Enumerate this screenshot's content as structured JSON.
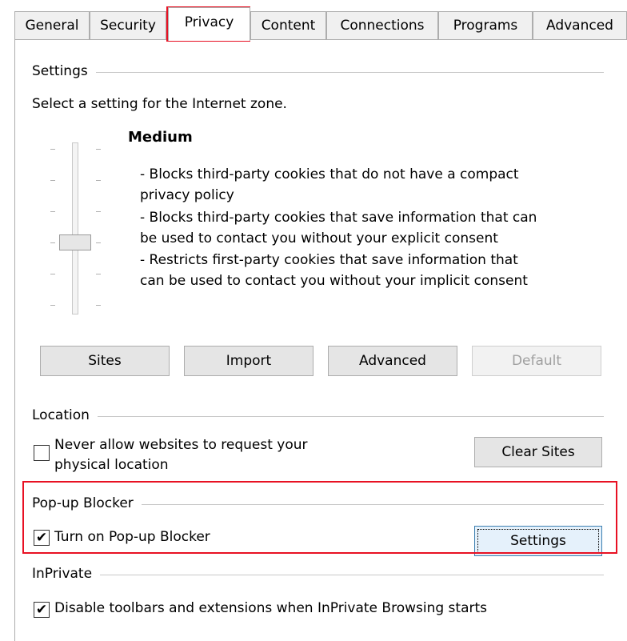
{
  "tabs": [
    "General",
    "Security",
    "Privacy",
    "Content",
    "Connections",
    "Programs",
    "Advanced"
  ],
  "active_tab": "Privacy",
  "settings": {
    "group_title": "Settings",
    "prompt": "Select a setting for the Internet zone.",
    "level": "Medium",
    "description": [
      "- Blocks third-party cookies that do not have a compact",
      "privacy policy",
      "- Blocks third-party cookies that save information that can",
      "be used to contact you without your explicit consent",
      "- Restricts first-party cookies that save information that",
      "can be used to contact you without your implicit consent"
    ],
    "buttons": {
      "sites": "Sites",
      "import": "Import",
      "advanced": "Advanced",
      "default": "Default"
    }
  },
  "location": {
    "group_title": "Location",
    "checkbox_label_line1": "Never allow websites to request your",
    "checkbox_label_line2": "physical location",
    "checked": false,
    "clear_sites": "Clear Sites"
  },
  "popup": {
    "group_title": "Pop-up Blocker",
    "checkbox_label": "Turn on Pop-up Blocker",
    "checked": true,
    "settings_button": "Settings"
  },
  "inprivate": {
    "group_title": "InPrivate",
    "checkbox_label": "Disable toolbars and extensions when InPrivate Browsing starts",
    "checked": true
  },
  "colors": {
    "highlight": "#e81123",
    "border": "#adadad"
  }
}
